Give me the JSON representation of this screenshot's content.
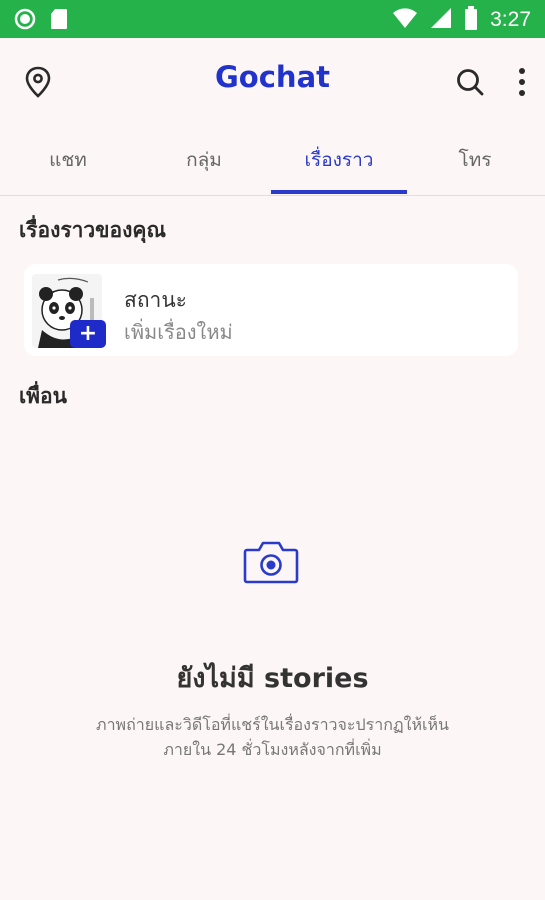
{
  "status_bar": {
    "time": "3:27",
    "icons": [
      "notification-dot-icon",
      "sd-card-icon",
      "wifi-icon",
      "cellular-signal-icon",
      "battery-icon"
    ]
  },
  "app_bar": {
    "title": "Gochat",
    "left_icon": "location-pin-icon",
    "right_icons": [
      "search-icon",
      "more-vertical-icon"
    ]
  },
  "tabs": [
    {
      "label": "แชท"
    },
    {
      "label": "กลุ่ม"
    },
    {
      "label": "เรื่องราว",
      "active": true
    },
    {
      "label": "โทร"
    }
  ],
  "your_stories": {
    "heading": "เรื่องราวของคุณ",
    "card": {
      "name": "สถานะ",
      "subtitle": "เพิ่มเรื่องใหม่",
      "badge": "+"
    }
  },
  "friends": {
    "heading": "เพื่อน"
  },
  "empty_state": {
    "icon": "camera-icon",
    "title": "ยังไม่มี stories",
    "description_line1": "ภาพถ่ายและวิดีโอที่แชร์ในเรื่องราวจะปรากฏให้เห็น",
    "description_line2": "ภายใน 24 ชั่วโมงหลังจากที่เพิ่ม"
  },
  "colors": {
    "status_bar": "#26b24a",
    "accent": "#2a3bcc",
    "background": "#fdf6f6"
  }
}
